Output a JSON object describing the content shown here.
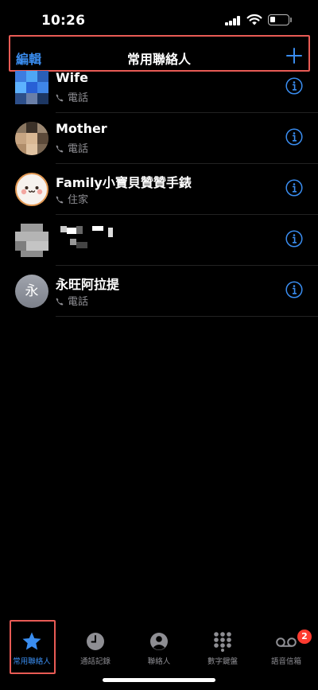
{
  "status_bar": {
    "time": "10:26"
  },
  "nav": {
    "edit_label": "編輯",
    "title": "常用聯絡人",
    "add_icon": "plus-icon"
  },
  "favorites": [
    {
      "name": "Wife",
      "label": "電話",
      "avatar": "pixelated-photo"
    },
    {
      "name": "Mother",
      "label": "電話",
      "avatar": "pixelated-photo"
    },
    {
      "name": "Family小寶貝贊贊手錶",
      "label": "住家",
      "avatar": "cute-face-sticker"
    },
    {
      "name": "",
      "label": "",
      "avatar": "pixelated-photo"
    },
    {
      "name": "永旺阿拉提",
      "label": "電話",
      "avatar": "initial",
      "initial": "永"
    }
  ],
  "tabs": [
    {
      "label": "常用聯絡人",
      "icon": "star-icon",
      "active": true
    },
    {
      "label": "通話記錄",
      "icon": "clock-icon",
      "active": false
    },
    {
      "label": "聯絡人",
      "icon": "person-icon",
      "active": false
    },
    {
      "label": "數字鍵盤",
      "icon": "keypad-icon",
      "active": false
    },
    {
      "label": "語音信箱",
      "icon": "voicemail-icon",
      "active": false,
      "badge": "2"
    }
  ],
  "colors": {
    "accent": "#3a8df0",
    "highlight": "#e85b55",
    "badge": "#ff3b30",
    "background": "#000000"
  }
}
